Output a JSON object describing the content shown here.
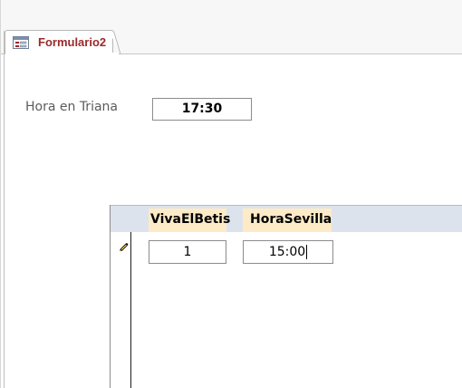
{
  "tab": {
    "label": "Formulario2",
    "icon": "form-icon",
    "label_color": "#9a2a2a"
  },
  "form": {
    "triana_label": "Hora en Triana",
    "triana_value": "17:30"
  },
  "subform": {
    "columns": [
      "VivaElBetis",
      "HoraSevilla"
    ],
    "rows": [
      {
        "vivaelbetis": "1",
        "horasevilla": "15:00"
      }
    ],
    "record_selector_icon": "pencil-edit-icon",
    "header_color": "#fdebc8"
  }
}
